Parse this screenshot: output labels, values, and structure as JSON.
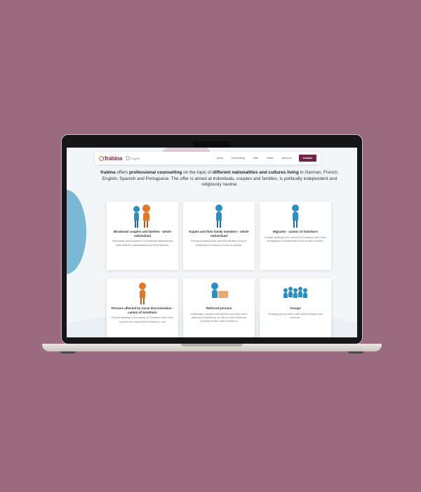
{
  "nav": {
    "logo": "frabina",
    "language": "English",
    "links": [
      "Home",
      "Counselling",
      "Offer",
      "News",
      "About us"
    ],
    "contact": "Contact"
  },
  "intro": {
    "brand": "frabina",
    "t1": " offers ",
    "b1": "professional counselling",
    "t2": " on the topic of ",
    "b2": "different nationalities and cultures living",
    "t3": " in German, French, English, Spanish and Portuguese. The offer is aimed at individuals, couples and families, is politically independent and religiously neutral."
  },
  "cards": [
    {
      "title": "Binational couples and families - whole switzerland",
      "desc": "Individuals and couples in a binational relationships (with different nationalities) and their families.",
      "icon": "couple-icon"
    },
    {
      "title": "Expats and their family members - whole switzerland",
      "desc": "Foreign professionals and their families living in Switzerland because of work or studies.",
      "icon": "expat-icon"
    },
    {
      "title": "Migrants - canton of Solothurn",
      "desc": "People residing in the canton of Solothurn who have immigrated to Switzerland from another country.",
      "icon": "migrant-icon"
    },
    {
      "title": "Persons affected by racist discrimination - canton of Solothurn",
      "desc": "People residing in the canton of Solothurn who have experienced racist discrimination or are",
      "icon": "affected-person-icon"
    },
    {
      "title": "Referred persons",
      "desc": "Individuals, couples and families who have been referred to frabina by an office of the Solothurn (Society of them (are) Solothurn",
      "icon": "referred-person-icon"
    },
    {
      "title": "Groups",
      "desc": "Changing group offers with different topics and contents.",
      "icon": "group-icon"
    }
  ],
  "colors": {
    "background": "#9a6a7e",
    "brand": "#6e2446",
    "accent_orange": "#d5722a",
    "accent_blue": "#2b8fc2"
  }
}
